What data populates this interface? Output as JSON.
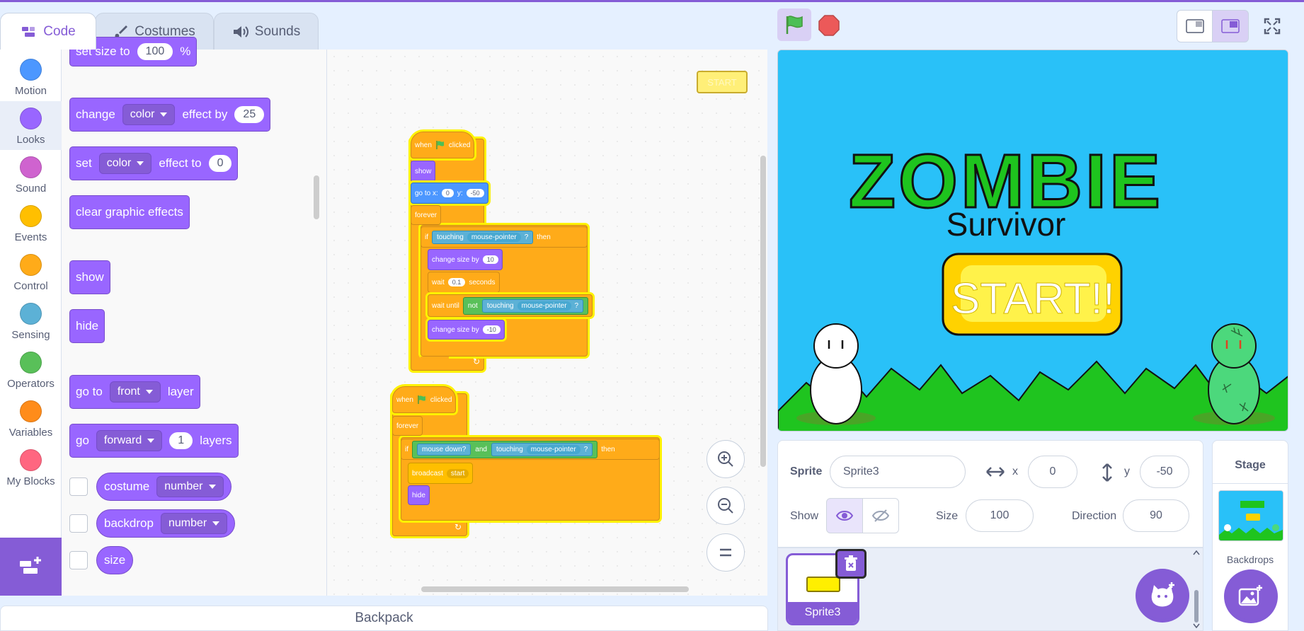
{
  "tabs": [
    {
      "label": "Code",
      "active": true,
      "icon": "code-icon"
    },
    {
      "label": "Costumes",
      "active": false,
      "icon": "brush-icon"
    },
    {
      "label": "Sounds",
      "active": false,
      "icon": "speaker-icon"
    }
  ],
  "categories": [
    {
      "label": "Motion",
      "color": "#4c97ff"
    },
    {
      "label": "Looks",
      "color": "#9966ff",
      "selected": true
    },
    {
      "label": "Sound",
      "color": "#cf63cf"
    },
    {
      "label": "Events",
      "color": "#ffbf00"
    },
    {
      "label": "Control",
      "color": "#ffab19"
    },
    {
      "label": "Sensing",
      "color": "#5cb1d6"
    },
    {
      "label": "Operators",
      "color": "#59c059"
    },
    {
      "label": "Variables",
      "color": "#ff8c1a"
    },
    {
      "label": "My Blocks",
      "color": "#ff6680"
    }
  ],
  "palette": {
    "set_size": {
      "text": "set size to",
      "value": "100",
      "unit": "%"
    },
    "change_effect": {
      "verb": "change",
      "effect": "color",
      "mid": "effect by",
      "value": "25"
    },
    "set_effect": {
      "verb": "set",
      "effect": "color",
      "mid": "effect to",
      "value": "0"
    },
    "clear_effects": "clear graphic effects",
    "show": "show",
    "hide": "hide",
    "go_to_layer": {
      "verb": "go to",
      "layer": "front",
      "tail": "layer"
    },
    "go_layers": {
      "verb": "go",
      "dir": "forward",
      "value": "1",
      "tail": "layers"
    },
    "costume_rep": {
      "label": "costume",
      "option": "number"
    },
    "backdrop_rep": {
      "label": "backdrop",
      "option": "number"
    },
    "size_rep": "size"
  },
  "script1": {
    "hat": {
      "when": "when",
      "clicked": "clicked"
    },
    "show": "show",
    "goto": {
      "label": "go to x:",
      "x": "0",
      "ylabel": "y:",
      "y": "-50"
    },
    "forever": "forever",
    "if": {
      "kw": "if",
      "touching": "touching",
      "target": "mouse-pointer",
      "q": "?",
      "then": "then"
    },
    "change1": {
      "label": "change size by",
      "value": "10"
    },
    "wait": {
      "label": "wait",
      "value": "0.1",
      "unit": "seconds"
    },
    "waituntil": {
      "label": "wait until",
      "not": "not",
      "touching": "touching",
      "target": "mouse-pointer",
      "q": "?"
    },
    "change2": {
      "label": "change size by",
      "value": "-10"
    }
  },
  "script2": {
    "hat": {
      "when": "when",
      "clicked": "clicked"
    },
    "forever": "forever",
    "if": {
      "kw": "if",
      "mouse": "mouse down?",
      "and": "and",
      "touching": "touching",
      "target": "mouse-pointer",
      "q": "?",
      "then": "then"
    },
    "broadcast": {
      "label": "broadcast",
      "msg": "start"
    },
    "hide": "hide"
  },
  "sprite_mini_label": "START",
  "backpack": "Backpack",
  "stage_art": {
    "title": "ZOMBIE",
    "subtitle": "Survivor",
    "button": "START!!"
  },
  "sprite_info": {
    "sprite_label": "Sprite",
    "sprite_name": "Sprite3",
    "x_label": "x",
    "x": "0",
    "y_label": "y",
    "y": "-50",
    "show_label": "Show",
    "size_label": "Size",
    "size": "100",
    "direction_label": "Direction",
    "direction": "90"
  },
  "sprite_list": [
    {
      "name": "Sprite3",
      "selected": true
    }
  ],
  "stage_panel": {
    "title": "Stage",
    "backdrops": "Backdrops"
  },
  "colors": {
    "accent": "#855cd6",
    "looks": "#9966ff",
    "events": "#ffab19",
    "stage_sky": "#29c1f8",
    "grass": "#1fc41f"
  }
}
